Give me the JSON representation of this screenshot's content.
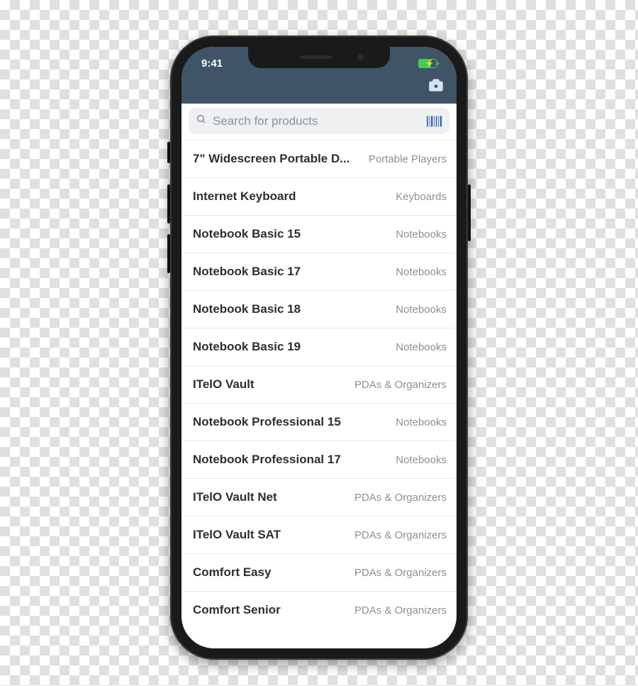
{
  "status": {
    "time": "9:41"
  },
  "search": {
    "placeholder": "Search for products"
  },
  "products": [
    {
      "name": "7\" Widescreen Portable D...",
      "category": "Portable Players"
    },
    {
      "name": "Internet Keyboard",
      "category": "Keyboards"
    },
    {
      "name": "Notebook Basic 15",
      "category": "Notebooks"
    },
    {
      "name": "Notebook Basic 17",
      "category": "Notebooks"
    },
    {
      "name": "Notebook Basic 18",
      "category": "Notebooks"
    },
    {
      "name": "Notebook Basic 19",
      "category": "Notebooks"
    },
    {
      "name": "ITelO Vault",
      "category": "PDAs & Organizers"
    },
    {
      "name": "Notebook Professional 15",
      "category": "Notebooks"
    },
    {
      "name": "Notebook Professional 17",
      "category": "Notebooks"
    },
    {
      "name": "ITelO Vault Net",
      "category": "PDAs & Organizers"
    },
    {
      "name": "ITelO Vault SAT",
      "category": "PDAs & Organizers"
    },
    {
      "name": "Comfort Easy",
      "category": "PDAs & Organizers"
    },
    {
      "name": "Comfort Senior",
      "category": "PDAs & Organizers"
    }
  ]
}
